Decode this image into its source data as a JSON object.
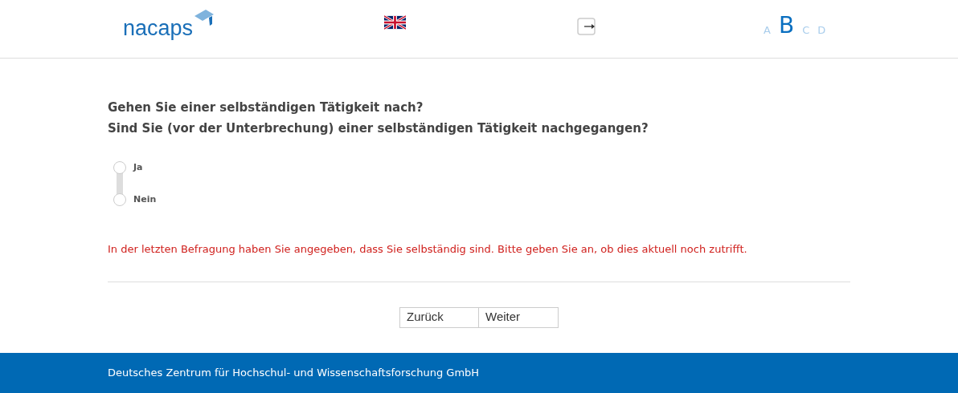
{
  "header": {
    "logo": "nacaps",
    "font_sizes": [
      {
        "label": "A",
        "selected": false
      },
      {
        "label": "B",
        "selected": true
      },
      {
        "label": "C",
        "selected": false
      },
      {
        "label": "D",
        "selected": false
      }
    ]
  },
  "question": {
    "lines": [
      "Gehen Sie einer selbständigen Tätigkeit nach?",
      "Sind Sie (vor der Unterbrechung) einer selbständigen Tätigkeit nachgegangen?"
    ],
    "options": [
      {
        "label": "Ja",
        "selected": false
      },
      {
        "label": "Nein",
        "selected": false
      }
    ],
    "hint": "In der letzten Befragung haben Sie angegeben, dass Sie selbständig sind. Bitte geben Sie an, ob dies aktuell noch zutrifft."
  },
  "buttons": [
    "Zurück",
    "Weiter"
  ],
  "footer": "Deutsches Zentrum für Hochschul- und Wissenschaftsforschung GmbH"
}
